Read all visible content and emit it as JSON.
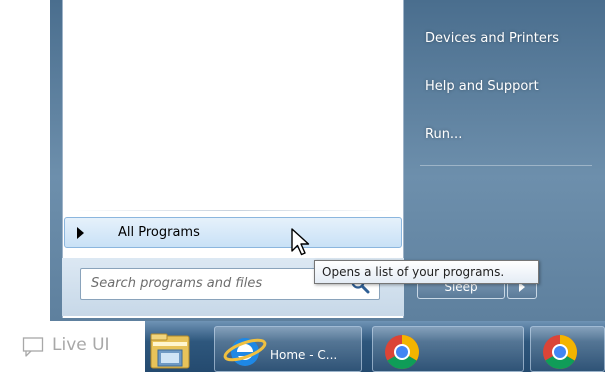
{
  "start_menu": {
    "left_pane": {
      "all_programs_label": "All Programs",
      "search_placeholder": "Search programs and files"
    },
    "right_pane": {
      "items": [
        "Devices and Printers",
        "Help and Support",
        "Run..."
      ],
      "sleep_label": "Sleep"
    },
    "tooltip": "Opens a list of your programs."
  },
  "taskbar": {
    "buttons": [
      {
        "icon": "folder-icon"
      },
      {
        "icon": "ie-icon",
        "label": "Home - C..."
      },
      {
        "icon": "chrome-icon"
      },
      {
        "icon": "chrome-icon"
      }
    ]
  },
  "watermark": {
    "label": "Live UI",
    "icon": "comment-icon"
  },
  "colors": {
    "start_menu_blue": "#5e809e",
    "highlight": "#c9e1f6",
    "taskbar": "#2e577d"
  }
}
